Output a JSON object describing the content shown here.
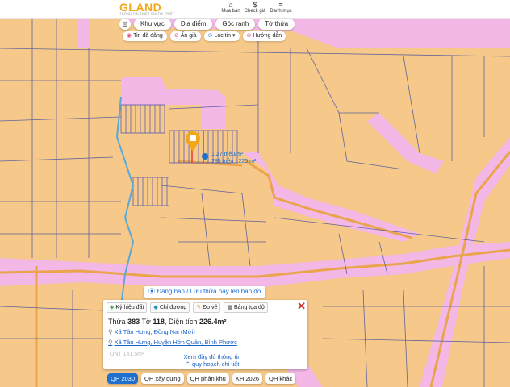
{
  "header": {
    "logo": "LAND",
    "logo_mark": "G",
    "logo_sub": "THÔNG TIN THIẾT GIÁ THỊ TRIỆT",
    "buttons": [
      {
        "label": "Mua bán",
        "icon": "house-icon"
      },
      {
        "label": "Check giá",
        "icon": "dollar-icon"
      },
      {
        "label": "Danh mục",
        "icon": "menu-icon"
      }
    ]
  },
  "search_tabs": [
    "Khu vực",
    "Địa điểm",
    "Góc ranh",
    "Tờ thửa"
  ],
  "filter_chips": [
    {
      "label": "Tin đã đăng",
      "icon": "tag-icon"
    },
    {
      "label": "Ẩn giá",
      "icon": "eye-off-icon"
    },
    {
      "label": "Lọc tin",
      "icon": "filter-icon"
    },
    {
      "label": "Hướng dẫn",
      "icon": "help-icon"
    }
  ],
  "map": {
    "price_per_m2": "1.27 triệu/m²",
    "price_total": "285 triệu · 225 m²",
    "upload_link": "Đăng bán / Lưu thửa này lên bản đồ"
  },
  "panel": {
    "tabs": [
      {
        "label": "Ký hiệu đất",
        "icon": "layers-icon"
      },
      {
        "label": "Chỉ đường",
        "icon": "directions-icon"
      },
      {
        "label": "Đo vẽ",
        "icon": "ruler-icon"
      },
      {
        "label": "Bảng tọa độ",
        "icon": "table-icon"
      }
    ],
    "plot_prefix": "Thửa",
    "plot_no": "383",
    "sheet_prefix": "Tờ",
    "sheet_no": "118",
    "area_prefix": ", Diện tích",
    "area": "226.4m²",
    "address_new": "Xã Tân Hưng, Đồng Nai (Mới)",
    "address_old": "Xã Tân Hưng, Huyện Hớn Quản, Bình Phước",
    "ghost_text": "ONT      141.5m²",
    "more_line1": "Xem đầy đủ thông tin",
    "more_line2": "quy hoạch chi tiết"
  },
  "bottom_tabs": [
    "QH 2030",
    "QH xây dựng",
    "QH phân khu",
    "KH 2026",
    "QH khác"
  ],
  "colors": {
    "land_orange": "#f6c98a",
    "road_pink": "#f3b8e6",
    "road_orange": "#e9a44c",
    "accent_blue": "#1f6fcf",
    "marker": "#f0a81a",
    "plot_highlight": "#e23a3a"
  }
}
